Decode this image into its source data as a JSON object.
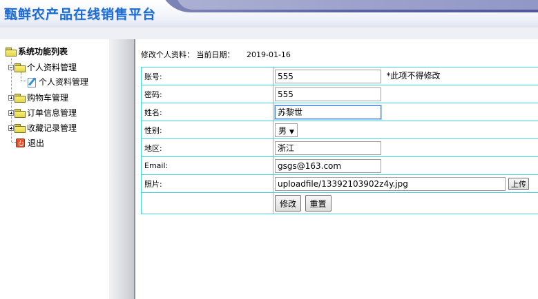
{
  "header": {
    "site_title": "甄鲜农产品在线销售平台"
  },
  "sidebar": {
    "root_label": "系统功能列表",
    "items": [
      {
        "label": "个人资料管理",
        "expanded": true,
        "icon": "folder-icon"
      },
      {
        "label": "个人资料管理",
        "child": true,
        "icon": "edit-doc-icon"
      },
      {
        "label": "购物车管理",
        "expanded": false,
        "icon": "folder-icon"
      },
      {
        "label": "订单信息管理",
        "expanded": false,
        "icon": "folder-icon"
      },
      {
        "label": "收藏记录管理",
        "expanded": false,
        "icon": "folder-icon"
      },
      {
        "label": "退出",
        "icon": "exit-icon"
      }
    ]
  },
  "main": {
    "heading": "修改个人资料：",
    "date_label": "当前日期：",
    "date_value": "2019-01-16",
    "form": {
      "account_label": "账号:",
      "account_value": "555",
      "account_note": "*此项不得修改",
      "password_label": "密码:",
      "password_value": "555",
      "name_label": "姓名:",
      "name_value": "苏黎世",
      "gender_label": "性别:",
      "gender_value": "男",
      "region_label": "地区:",
      "region_value": "浙江",
      "email_label": "Email:",
      "email_value": "gsgs@163.com",
      "photo_label": "照片:",
      "photo_value": "uploadfile/13392103902z4y.jpg",
      "upload_label": "上传",
      "submit_label": "修改",
      "reset_label": "重置"
    }
  },
  "colors": {
    "title": "#1e6bd0",
    "table_border": "#45d4e3",
    "focus_border": "#3c7fd6"
  }
}
